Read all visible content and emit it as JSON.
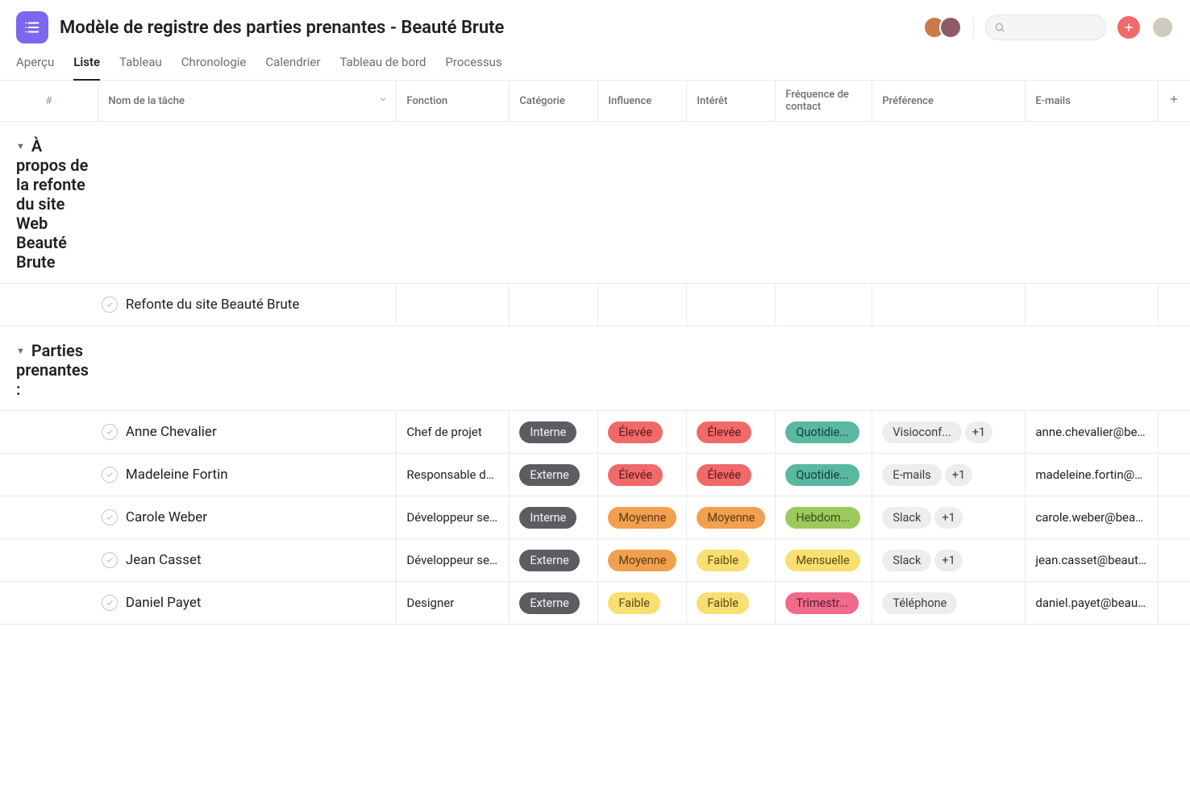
{
  "header": {
    "title": "Modèle de registre des parties prenantes - Beauté Brute"
  },
  "tabs": [
    {
      "id": "overview",
      "label": "Aperçu"
    },
    {
      "id": "list",
      "label": "Liste",
      "active": true
    },
    {
      "id": "board",
      "label": "Tableau"
    },
    {
      "id": "timeline",
      "label": "Chronologie"
    },
    {
      "id": "calendar",
      "label": "Calendrier"
    },
    {
      "id": "dashboard",
      "label": "Tableau de bord"
    },
    {
      "id": "process",
      "label": "Processus"
    }
  ],
  "columns": {
    "num": "#",
    "name": "Nom de la tâche",
    "fn": "Fonction",
    "cat": "Catégorie",
    "inf": "Influence",
    "int": "Intérêt",
    "freq": "Fréquence de contact",
    "pref": "Préférence",
    "email": "E-mails"
  },
  "sections": [
    {
      "title": "À propos de la refonte du site Web Beauté Brute",
      "rows": [
        {
          "name": "Refonte du site Beauté Brute",
          "fn": "",
          "cat": null,
          "inf": null,
          "int": null,
          "freq": null,
          "pref": [],
          "email": ""
        }
      ]
    },
    {
      "title": "Parties prenantes :",
      "rows": [
        {
          "name": "Anne Chevalier",
          "fn": "Chef de projet",
          "cat": {
            "label": "Interne",
            "color": "dark"
          },
          "inf": {
            "label": "Élevée",
            "color": "red"
          },
          "int": {
            "label": "Élevée",
            "color": "red"
          },
          "freq": {
            "label": "Quotidie...",
            "color": "green"
          },
          "pref": [
            {
              "label": "Visioconf...",
              "color": "gray"
            },
            {
              "label": "+1",
              "color": "more"
            }
          ],
          "email": "anne.chevalier@bea..."
        },
        {
          "name": "Madeleine Fortin",
          "fn": "Responsable du...",
          "cat": {
            "label": "Externe",
            "color": "dark"
          },
          "inf": {
            "label": "Élevée",
            "color": "red"
          },
          "int": {
            "label": "Élevée",
            "color": "red"
          },
          "freq": {
            "label": "Quotidie...",
            "color": "green"
          },
          "pref": [
            {
              "label": "E-mails",
              "color": "gray"
            },
            {
              "label": "+1",
              "color": "more"
            }
          ],
          "email": "madeleine.fortin@b..."
        },
        {
          "name": "Carole Weber",
          "fn": "Développeur sen...",
          "cat": {
            "label": "Interne",
            "color": "dark"
          },
          "inf": {
            "label": "Moyenne",
            "color": "orange"
          },
          "int": {
            "label": "Moyenne",
            "color": "orange"
          },
          "freq": {
            "label": "Hebdom...",
            "color": "olive"
          },
          "pref": [
            {
              "label": "Slack",
              "color": "gray"
            },
            {
              "label": "+1",
              "color": "more"
            }
          ],
          "email": "carole.weber@beau..."
        },
        {
          "name": "Jean Casset",
          "fn": "Développeur sen...",
          "cat": {
            "label": "Externe",
            "color": "dark"
          },
          "inf": {
            "label": "Moyenne",
            "color": "orange"
          },
          "int": {
            "label": "Faible",
            "color": "yellow"
          },
          "freq": {
            "label": "Mensuelle",
            "color": "yellow"
          },
          "pref": [
            {
              "label": "Slack",
              "color": "gray"
            },
            {
              "label": "+1",
              "color": "more"
            }
          ],
          "email": "jean.casset@beaut..."
        },
        {
          "name": "Daniel Payet",
          "fn": "Designer",
          "cat": {
            "label": "Externe",
            "color": "dark"
          },
          "inf": {
            "label": "Faible",
            "color": "yellow"
          },
          "int": {
            "label": "Faible",
            "color": "yellow"
          },
          "freq": {
            "label": "Trimestr...",
            "color": "rose"
          },
          "pref": [
            {
              "label": "Téléphone",
              "color": "gray"
            }
          ],
          "email": "daniel.payet@beaut..."
        }
      ]
    }
  ]
}
